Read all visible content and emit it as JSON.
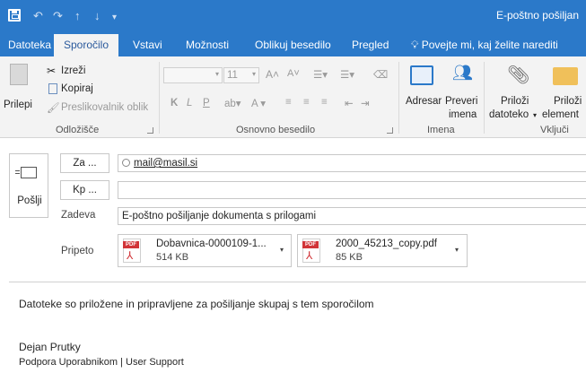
{
  "titlebar": {
    "title": "E-poštno pošiljan",
    "icons": [
      "save-icon",
      "undo-icon",
      "redo-icon",
      "up-arrow-icon",
      "down-arrow-icon",
      "customize-icon"
    ]
  },
  "tabs": [
    {
      "label": "Datoteka"
    },
    {
      "label": "Sporočilo"
    },
    {
      "label": "Vstavi"
    },
    {
      "label": "Možnosti"
    },
    {
      "label": "Oblikuj besedilo"
    },
    {
      "label": "Pregled"
    },
    {
      "label": "Povejte mi, kaj želite narediti"
    }
  ],
  "ribbon": {
    "clipboard": {
      "paste": "Prilepi",
      "cut": "Izreži",
      "copy": "Kopiraj",
      "format_painter": "Preslikovalnik oblik",
      "group": "Odložišče"
    },
    "text": {
      "font_size": "11",
      "bold": "K",
      "italic": "L",
      "underline": "P",
      "group": "Osnovno besedilo"
    },
    "names": {
      "address_book": "Adresar",
      "check_names_1": "Preveri",
      "check_names_2": "imena",
      "group": "Imena"
    },
    "include": {
      "attach_file_1": "Priloži",
      "attach_file_2": "datoteko",
      "attach_item_1": "Priloži",
      "attach_item_2": "element",
      "group": "Vključi"
    }
  },
  "compose": {
    "send": "Pošlji",
    "to_button": "Za ...",
    "cc_button": "Kp ...",
    "to_value": "mail@masil.si",
    "cc_value": "",
    "subject_label": "Zadeva",
    "subject_value": "E-poštno pošiljanje dokumenta s prilogami",
    "attached_label": "Pripeto",
    "attachments": [
      {
        "name": "Dobavnica-0000109-1...",
        "size": "514 KB",
        "icon_label": "PDF"
      },
      {
        "name": "2000_45213_copy.pdf",
        "size": "85 KB",
        "icon_label": "PDF"
      }
    ]
  },
  "message": {
    "line1": "Datoteke so priložene in pripravljene za pošiljanje skupaj s tem sporočilom",
    "signature_name": "Dejan Prutky",
    "signature_title": "Podpora Uporabnikom | User Support"
  },
  "colors": {
    "accent": "#2b79c9",
    "ribbon": "#f3f3f3",
    "pdf_red": "#d13438"
  }
}
